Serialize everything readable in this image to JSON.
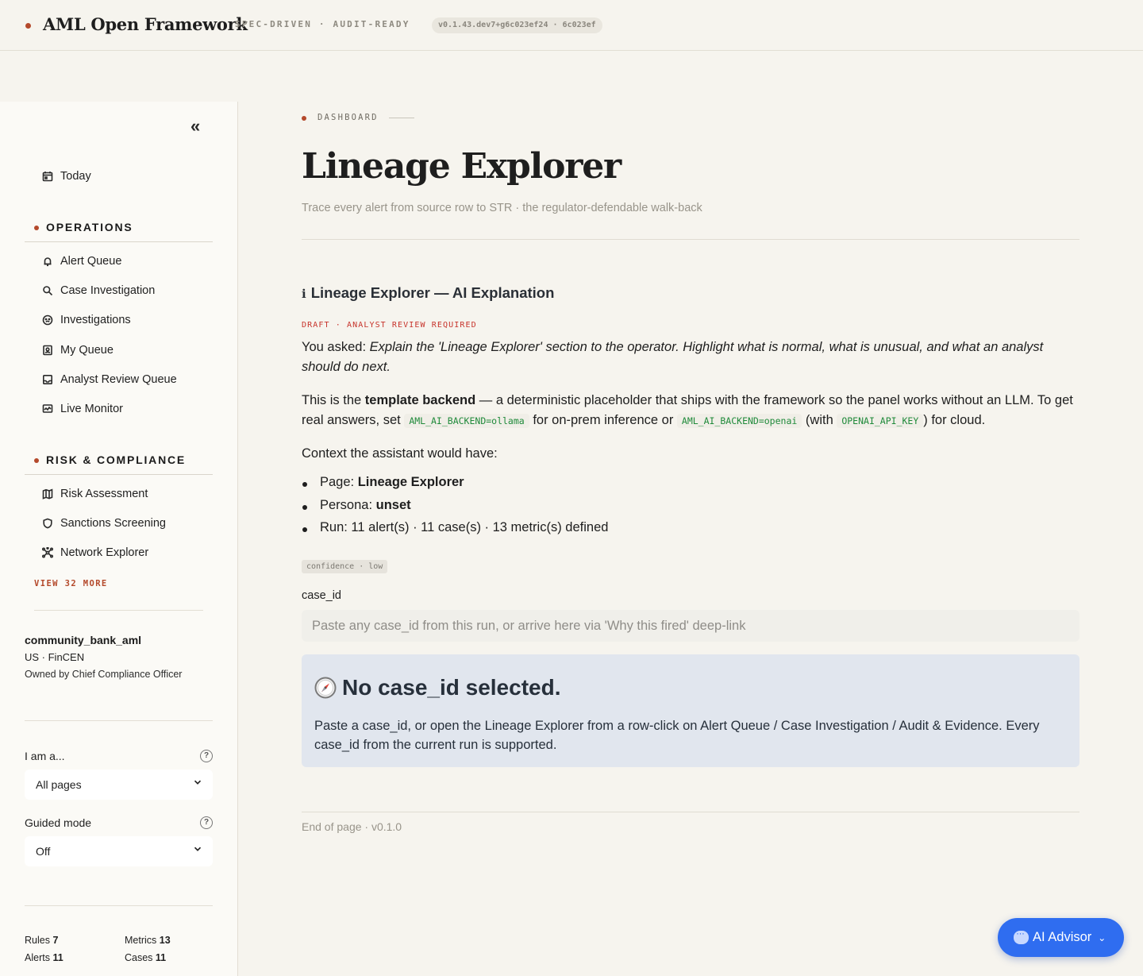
{
  "header": {
    "brand": "AML Open Framework",
    "tagline": "SPEC-DRIVEN · AUDIT-READY",
    "version": "v0.1.43.dev7+g6c023ef24 · 6c023ef"
  },
  "sidebar": {
    "collapse_glyph": "«",
    "today": "Today",
    "sections": [
      {
        "title": "OPERATIONS",
        "items": [
          {
            "label": "Alert Queue",
            "icon": "bell-icon"
          },
          {
            "label": "Case Investigation",
            "icon": "search-icon"
          },
          {
            "label": "Investigations",
            "icon": "face-icon"
          },
          {
            "label": "My Queue",
            "icon": "user-badge-icon"
          },
          {
            "label": "Analyst Review Queue",
            "icon": "inbox-icon"
          },
          {
            "label": "Live Monitor",
            "icon": "monitor-icon"
          }
        ]
      },
      {
        "title": "RISK & COMPLIANCE",
        "items": [
          {
            "label": "Risk Assessment",
            "icon": "map-icon"
          },
          {
            "label": "Sanctions Screening",
            "icon": "shield-icon"
          },
          {
            "label": "Network Explorer",
            "icon": "network-icon"
          }
        ]
      }
    ],
    "view_more": "VIEW 32 MORE",
    "tenant": {
      "name": "community_bank_aml",
      "jurisdiction": "US · FinCEN",
      "owner": "Owned by Chief Compliance Officer"
    },
    "persona": {
      "label": "I am a...",
      "value": "All pages"
    },
    "guided": {
      "label": "Guided mode",
      "value": "Off"
    },
    "stats": {
      "rules_label": "Rules",
      "rules": "7",
      "metrics_label": "Metrics",
      "metrics": "13",
      "alerts_label": "Alerts",
      "alerts": "11",
      "cases_label": "Cases",
      "cases": "11"
    }
  },
  "main": {
    "breadcrumb": "DASHBOARD",
    "title": "Lineage Explorer",
    "subtitle": "Trace every alert from source row to STR · the regulator-defendable walk-back",
    "ai": {
      "title": "Lineage Explorer — AI Explanation",
      "info_glyph": "ℹ",
      "draft_label": "DRAFT · ANALYST REVIEW REQUIRED",
      "asked_prefix": "You asked: ",
      "asked_text": "Explain the 'Lineage Explorer' section to the operator. Highlight what is normal, what is unusual, and what an analyst should do next.",
      "p2_a": "This is the ",
      "p2_bold": "template backend",
      "p2_b": " — a deterministic placeholder that ships with the framework so the panel works without an LLM. To get real answers, set ",
      "code1": "AML_AI_BACKEND=ollama",
      "p2_c": " for on-prem inference or ",
      "code2": "AML_AI_BACKEND=openai",
      "p2_d": " (with ",
      "code3": "OPENAI_API_KEY",
      "p2_e": ") for cloud.",
      "context_heading": "Context the assistant would have:",
      "bullets": {
        "page_label": "Page: ",
        "page_value": "Lineage Explorer",
        "persona_label": "Persona: ",
        "persona_value": "unset",
        "run": "Run: 11 alert(s) · 11 case(s) · 13 metric(s) defined"
      },
      "confidence": "confidence · low"
    },
    "case_field": {
      "label": "case_id",
      "placeholder": "Paste any case_id from this run, or arrive here via 'Why this fired' deep-link",
      "value": ""
    },
    "notice": {
      "icon": "compass-icon",
      "title": "No case_id selected.",
      "text": "Paste a case_id, or open the Lineage Explorer from a row-click on Alert Queue / Case Investigation / Audit & Evidence. Every case_id from the current run is supported."
    },
    "footer": "End of page · v0.1.0"
  },
  "advisor": {
    "label": "AI Advisor",
    "chevron": "⌄"
  },
  "colors": {
    "accent": "#b4492b",
    "advisor": "#2f6df0",
    "notice_bg": "#e1e6ee",
    "code": "#1f8a3a",
    "draft": "#c7332b"
  }
}
